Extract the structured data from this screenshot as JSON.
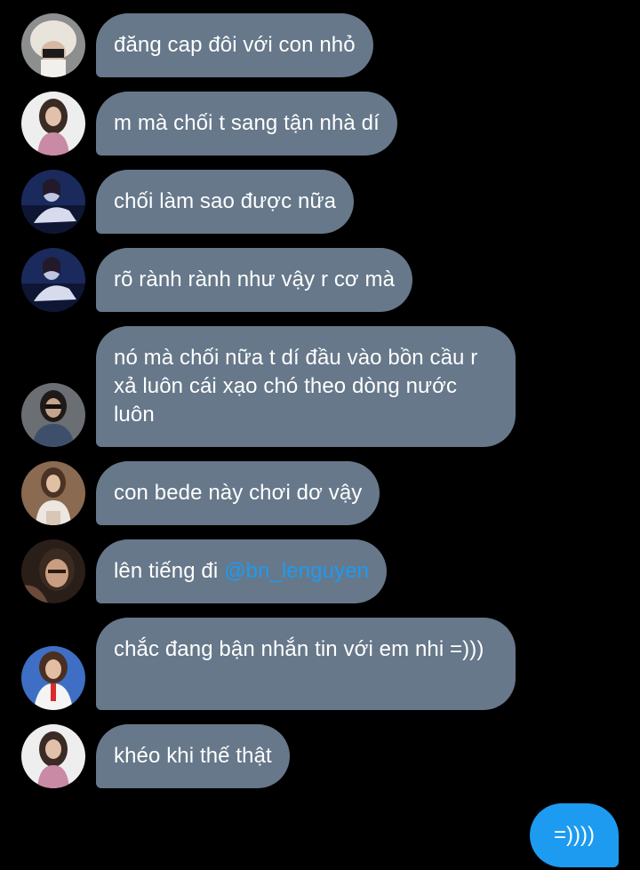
{
  "conversation": {
    "messages": [
      {
        "text": "đăng cap đôi với con nhỏ"
      },
      {
        "text": "m mà chối t sang tận nhà dí"
      },
      {
        "text": "chối làm sao được nữa"
      },
      {
        "text": "rõ rành rành như vậy r cơ mà"
      },
      {
        "text": "nó mà chối nữa t dí đầu vào bồn cầu r xả luôn cái xạo chó theo dòng nước luôn"
      },
      {
        "text": "con bede này chơi dơ vậy"
      },
      {
        "text_prefix": "lên tiếng đi ",
        "mention": "@bn_lenguyen"
      },
      {
        "text": "chắc đang bận nhắn tin với em nhi =)))"
      },
      {
        "text": "khéo khi thế thật"
      }
    ],
    "sent_message": "=))))"
  },
  "colors": {
    "background": "#000000",
    "received_bubble": "#66788a",
    "sent_bubble": "#1d9bf0",
    "mention": "#1d9bf0",
    "text": "#ffffff"
  }
}
